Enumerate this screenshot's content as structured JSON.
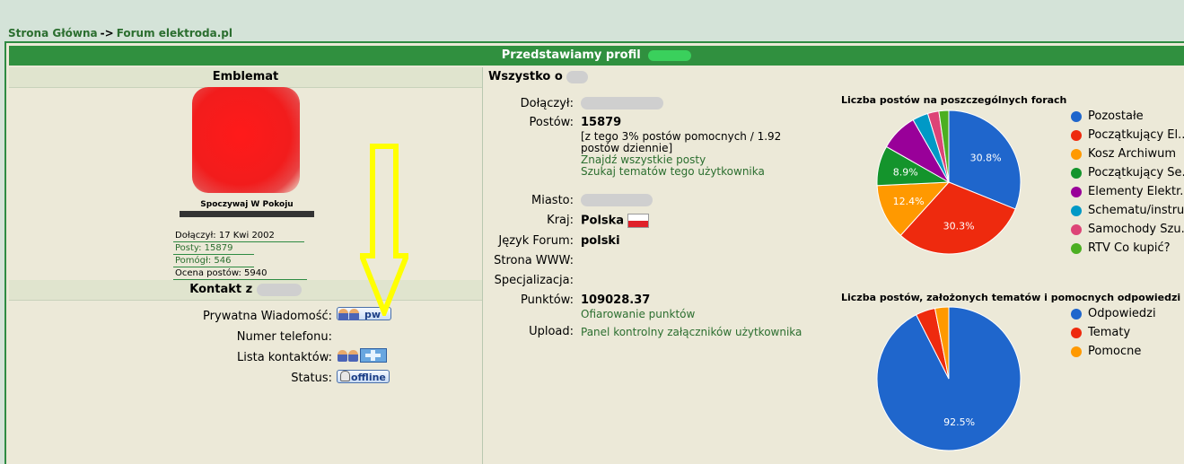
{
  "breadcrumb": {
    "home": "Strona Główna",
    "separator": "->",
    "forum": "Forum elektroda.pl"
  },
  "title": "Przedstawiamy profil",
  "left": {
    "emblem_header": "Emblemat",
    "avatar_caption": "Spoczywaj W Pokoju",
    "stats": {
      "joined": "Dołączył: 17 Kwi 2002",
      "posts": "Posty: 15879",
      "helped": "Pomógł: 546",
      "rating": "Ocena postów: 5940"
    },
    "contact_header": "Kontakt z",
    "contact": {
      "pm_label": "Prywatna Wiadomość:",
      "pm_button": "pw",
      "phone_label": "Numer telefonu:",
      "contacts_label": "Lista kontaktów:",
      "status_label": "Status:",
      "status_button": "offline"
    }
  },
  "right": {
    "header": "Wszystko o",
    "info": {
      "joined_label": "Dołączył:",
      "posts_label": "Postów:",
      "posts_value": "15879",
      "posts_detail": "[z tego 3% postów pomocnych / 1.92 postów dziennie]",
      "find_posts": "Znajdź wszystkie posty",
      "find_topics": "Szukaj tematów tego użytkownika",
      "city_label": "Miasto:",
      "country_label": "Kraj:",
      "country_value": "Polska",
      "lang_label": "Język Forum:",
      "lang_value": "polski",
      "www_label": "Strona WWW:",
      "spec_label": "Specjalizacja:",
      "points_label": "Punktów:",
      "points_value": "109028.37",
      "give_points": "Ofiarowanie punktów",
      "upload_label": "Upload:",
      "upload_value": "Panel kontrolny załączników użytkownika"
    }
  },
  "chart_data": [
    {
      "type": "pie",
      "title": "Liczba postów na poszczególnych forach",
      "categories": [
        "Pozostałe",
        "Początkujący El...",
        "Kosz Archiwum",
        "Początkujący Se...",
        "Elementy Elektr...",
        "Schematu/instru...",
        "Samochody Szu...",
        "RTV Co kupić?"
      ],
      "values": [
        30.8,
        30.3,
        12.4,
        8.9,
        8.4,
        3.5,
        2.5,
        2.2
      ],
      "labels": [
        "30.8%",
        "30.3%",
        "12.4%",
        "8.9%",
        "",
        "",
        "",
        ""
      ],
      "colors": [
        "#1f66cc",
        "#ee2a0e",
        "#ff9900",
        "#14942c",
        "#990099",
        "#0099c6",
        "#dd4477",
        "#4caf22"
      ],
      "legend": "right"
    },
    {
      "type": "pie",
      "title": "Liczba postów, założonych tematów i pomocnych odpowiedzi",
      "categories": [
        "Odpowiedzi",
        "Tematy",
        "Pomocne"
      ],
      "values": [
        92.5,
        4.4,
        3.1
      ],
      "labels": [
        "92.5%",
        "",
        ""
      ],
      "colors": [
        "#1f66cc",
        "#ee2a0e",
        "#ff9900"
      ],
      "legend": "right"
    }
  ]
}
